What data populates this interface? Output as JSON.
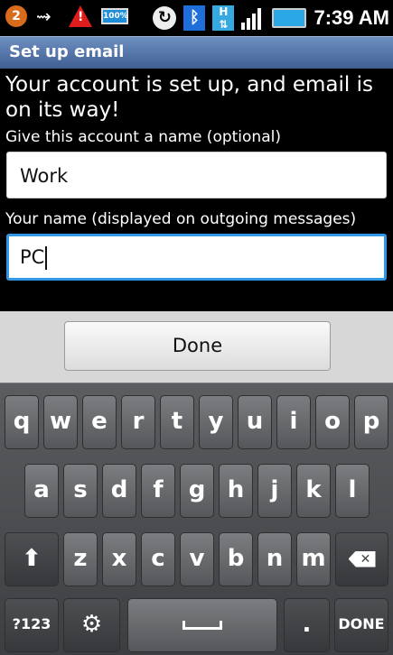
{
  "status_bar": {
    "time": "7:39 AM",
    "notification_count": "2",
    "battery_small_label": "100%",
    "icons": [
      "notification-icon",
      "usb-icon",
      "warning-icon",
      "battery-full-icon",
      "sync-icon",
      "bluetooth-icon",
      "hspa-icon",
      "signal-icon",
      "battery-icon"
    ]
  },
  "title_bar": {
    "title": "Set up email"
  },
  "form": {
    "message": "Your account is set up, and email is on its way!",
    "account_name_label": "Give this account a name (optional)",
    "account_name_value": "Work",
    "your_name_label": "Your name (displayed on outgoing messages)",
    "your_name_value": "PC"
  },
  "actions": {
    "done_label": "Done"
  },
  "keyboard": {
    "row1": [
      "q",
      "w",
      "e",
      "r",
      "t",
      "y",
      "u",
      "i",
      "o",
      "p"
    ],
    "row2": [
      "a",
      "s",
      "d",
      "f",
      "g",
      "h",
      "j",
      "k",
      "l"
    ],
    "row3": [
      "z",
      "x",
      "c",
      "v",
      "b",
      "n",
      "m"
    ],
    "symbols_label": "?123",
    "period_label": ".",
    "done_key_label": "DONE",
    "settings_icon": "gear-icon",
    "shift_icon": "shift-icon",
    "delete_icon": "backspace-icon",
    "space_icon": "space-icon"
  },
  "colors": {
    "title_bar": "#4a6aa0",
    "focus_border": "#2f97e6",
    "keyboard_bg": "#4a4c4f"
  }
}
